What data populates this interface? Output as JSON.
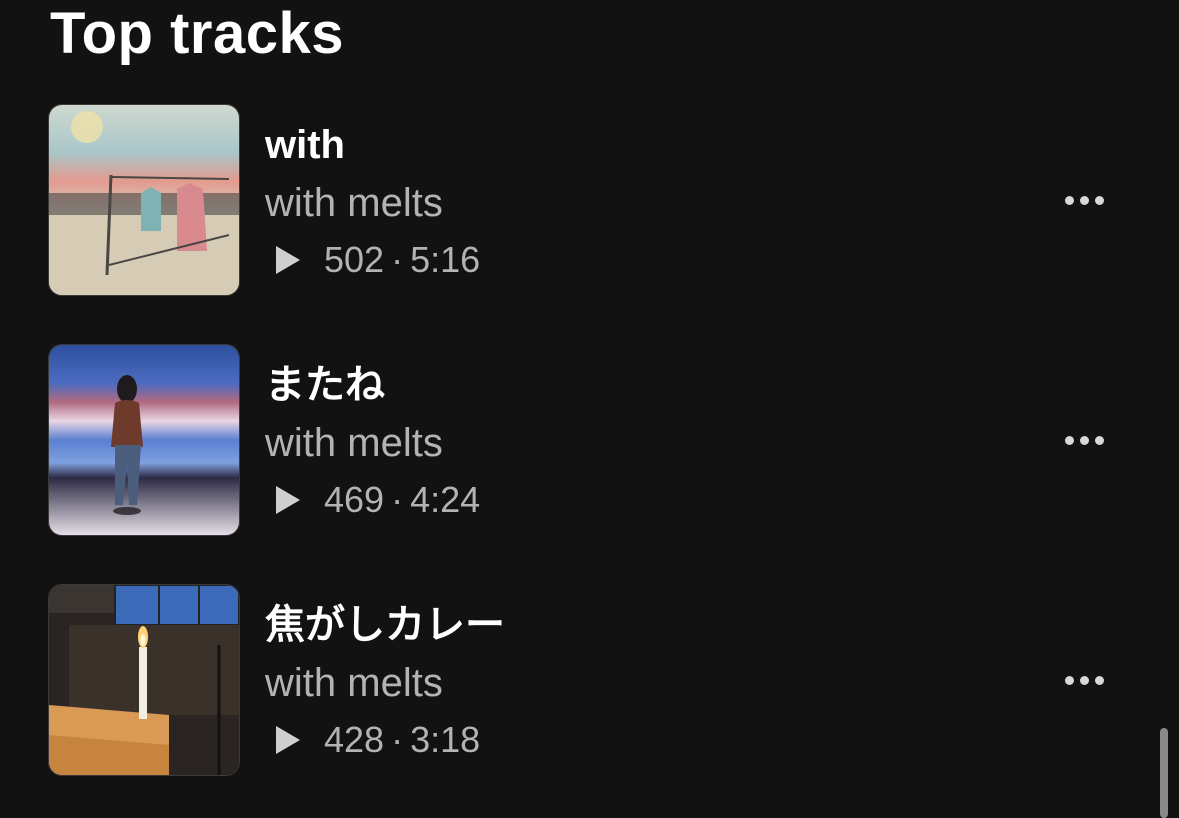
{
  "section": {
    "title": "Top tracks"
  },
  "tracks": [
    {
      "title": "with",
      "artist": "with melts",
      "plays": "502",
      "separator": "·",
      "duration": "5:16",
      "more_icon": "more-horizontal-icon",
      "play_icon": "play-icon"
    },
    {
      "title": "またね",
      "artist": "with melts",
      "plays": "469",
      "separator": "·",
      "duration": "4:24",
      "more_icon": "more-horizontal-icon",
      "play_icon": "play-icon"
    },
    {
      "title": "焦がしカレー",
      "artist": "with melts",
      "plays": "428",
      "separator": "·",
      "duration": "3:18",
      "more_icon": "more-horizontal-icon",
      "play_icon": "play-icon"
    }
  ],
  "colors": {
    "background": "#121212",
    "title": "#ffffff",
    "secondary_text": "#b3b3b3",
    "scrollbar": "#8a8a8a"
  }
}
